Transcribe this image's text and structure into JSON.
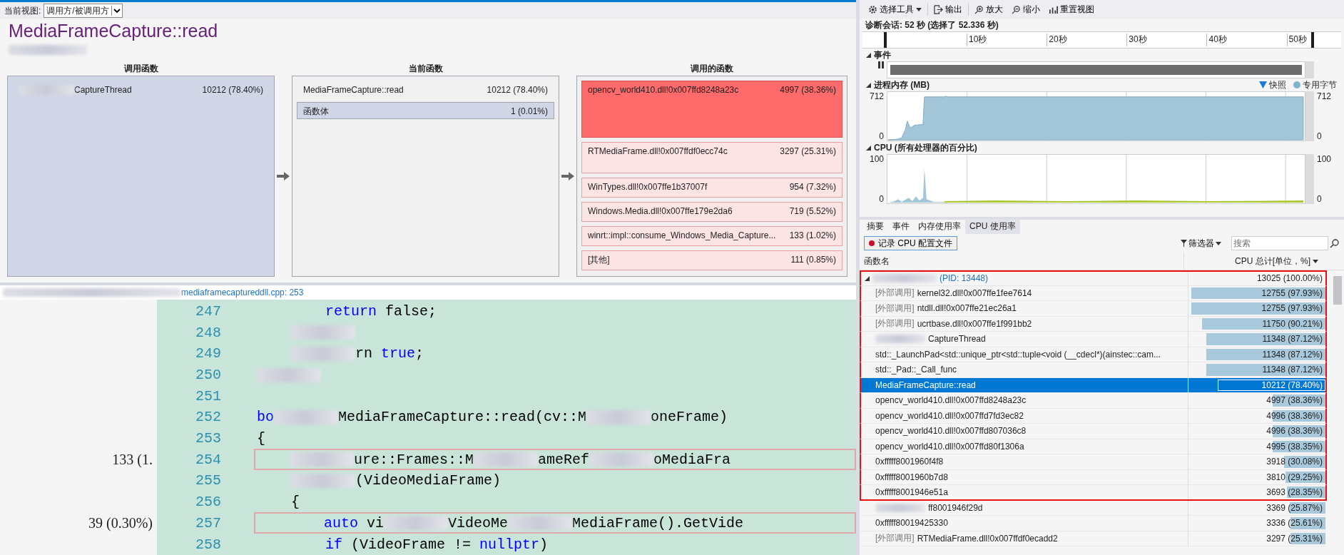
{
  "left": {
    "toolbar": {
      "label": "当前视图:",
      "view": "调用方/被调用方"
    },
    "title": "MediaFrameCapture::read",
    "callers": {
      "heading": "调用函数",
      "items": [
        {
          "name": "CaptureThread",
          "value": "10212 (78.40%)",
          "redacted": true
        }
      ]
    },
    "current": {
      "heading": "当前函数",
      "function": {
        "name": "MediaFrameCapture::read",
        "value": "10212 (78.40%)"
      },
      "items": [
        {
          "name": "函数体",
          "value": "1 (0.01%)"
        }
      ]
    },
    "callees": {
      "heading": "调用的函数",
      "items": [
        {
          "name": "opencv_world410.dll!0x007ffd8248a23c",
          "value": "4997 (38.36%)",
          "hot": true
        },
        {
          "name": "RTMediaFrame.dll!0x007ffdf0ecc74c",
          "value": "3297 (25.31%)",
          "hot": false
        },
        {
          "name": "WinTypes.dll!0x007ffe1b37007f",
          "value": "954 (7.32%)",
          "hot": false
        },
        {
          "name": "Windows.Media.dll!0x007ffe179e2da6",
          "value": "719 (5.52%)",
          "hot": false
        },
        {
          "name": "winrt::impl::consume_Windows_Media_Capture...",
          "value": "133 (1.02%)",
          "hot": false
        },
        {
          "name": "[其他]",
          "value": "111 (0.85%)",
          "hot": false
        }
      ]
    },
    "file": {
      "path": "mediaframecaptureddll.cpp: 253",
      "redacted": true
    },
    "code": [
      {
        "number": "247",
        "boxed": false,
        "segments": [
          {
            "kind": "indent"
          },
          {
            "kind": "indent"
          },
          {
            "kind": "keyword",
            "text": "return"
          },
          {
            "kind": "plain",
            "text": " false;"
          }
        ]
      },
      {
        "number": "248",
        "boxed": false,
        "segments": [
          {
            "kind": "indent"
          },
          {
            "kind": "redacted"
          }
        ]
      },
      {
        "number": "249",
        "boxed": false,
        "segments": [
          {
            "kind": "indent"
          },
          {
            "kind": "redacted"
          },
          {
            "kind": "plain",
            "text": "rn "
          },
          {
            "kind": "keyword",
            "text": "true"
          },
          {
            "kind": "plain",
            "text": ";"
          }
        ]
      },
      {
        "number": "250",
        "boxed": false,
        "segments": [
          {
            "kind": "redacted"
          }
        ]
      },
      {
        "number": "251",
        "boxed": false
      },
      {
        "number": "252",
        "boxed": false,
        "segments": [
          {
            "kind": "keyword",
            "text": "bo"
          },
          {
            "kind": "redacted"
          },
          {
            "kind": "plain",
            "text": "MediaFrameCapture::read(cv::M"
          },
          {
            "kind": "redacted"
          },
          {
            "kind": "plain",
            "text": "oneFrame)"
          }
        ]
      },
      {
        "number": "253",
        "boxed": false,
        "segments": [
          {
            "kind": "plain",
            "text": "{"
          }
        ]
      },
      {
        "number": "254",
        "count": "133 (1.",
        "boxed": true,
        "segments": [
          {
            "kind": "indent"
          },
          {
            "kind": "redacted"
          },
          {
            "kind": "plain",
            "text": "ure::Frames::M"
          },
          {
            "kind": "redacted"
          },
          {
            "kind": "plain",
            "text": "ameRef"
          },
          {
            "kind": "redacted"
          },
          {
            "kind": "plain",
            "text": "oMediaFra"
          }
        ]
      },
      {
        "number": "255",
        "boxed": false,
        "segments": [
          {
            "kind": "indent"
          },
          {
            "kind": "redacted"
          },
          {
            "kind": "plain",
            "text": "(VideoMediaFrame)"
          }
        ]
      },
      {
        "number": "256",
        "boxed": false,
        "segments": [
          {
            "kind": "indent"
          },
          {
            "kind": "plain",
            "text": "{"
          }
        ]
      },
      {
        "number": "257",
        "count": "39 (0.30%)",
        "boxed": true,
        "segments": [
          {
            "kind": "indent"
          },
          {
            "kind": "indent"
          },
          {
            "kind": "keyword",
            "text": "auto"
          },
          {
            "kind": "plain",
            "text": " vi"
          },
          {
            "kind": "redacted"
          },
          {
            "kind": "plain",
            "text": "VideoMe"
          },
          {
            "kind": "redacted"
          },
          {
            "kind": "plain",
            "text": "MediaFrame().GetVide"
          }
        ]
      },
      {
        "number": "258",
        "boxed": false,
        "segments": [
          {
            "kind": "indent"
          },
          {
            "kind": "indent"
          },
          {
            "kind": "keyword",
            "text": "if"
          },
          {
            "kind": "plain",
            "text": " (VideoFrame != "
          },
          {
            "kind": "keyword",
            "text": "nullptr"
          },
          {
            "kind": "plain",
            "text": ")"
          }
        ]
      }
    ]
  },
  "right": {
    "toolbar": [
      {
        "label": "选择工具",
        "kind": "dropdown"
      },
      {
        "label": "输出",
        "kind": "button"
      },
      {
        "label": "放大",
        "kind": "button"
      },
      {
        "label": "缩小",
        "kind": "button"
      },
      {
        "label": "重置视图",
        "kind": "button"
      }
    ],
    "session": "诊断会话: 52 秒 (选择了 52.336 秒)",
    "ruler": [
      "10秒",
      "20秒",
      "30秒",
      "40秒",
      "50秒"
    ],
    "events": {
      "heading": "事件",
      "expanded": true
    },
    "memory": {
      "heading": "进程内存 (MB)",
      "expanded": true,
      "legend": [
        "快照",
        "专用字节"
      ],
      "left_axis": [
        "712",
        "0"
      ],
      "right_axis": [
        "712",
        "0"
      ]
    },
    "cpu": {
      "heading": "CPU (所有处理器的百分比)",
      "expanded": true,
      "left_axis": [
        "100",
        "0"
      ],
      "right_axis": [
        "100",
        "0"
      ]
    },
    "tabs": [
      {
        "label": "摘要",
        "selected": false
      },
      {
        "label": "事件",
        "selected": false
      },
      {
        "label": "内存使用率",
        "selected": false
      },
      {
        "label": "CPU 使用率",
        "selected": true
      }
    ],
    "record_button": "记录 CPU 配置文件",
    "filter": "筛选器",
    "search": {
      "placeholder": "搜索"
    },
    "columns": [
      "函数名",
      "CPU 总计[单位，%]"
    ],
    "tree": {
      "name": "(PID: 13448)",
      "value": "13025 (100.00%)",
      "redacted": true,
      "highlighted": true,
      "selected": false,
      "expanded": true,
      "children": [
        {
          "prefix": "[外部调用]",
          "name": "kernel32.dll!0x007ffe1fee7614",
          "value": "12755 (97.93%)",
          "level": 0.9793,
          "highlighted": true,
          "selected": false
        },
        {
          "prefix": "[外部调用]",
          "name": "ntdll.dll!0x007ffe21ec26a1",
          "value": "12755 (97.93%)",
          "level": 0.9793,
          "highlighted": true,
          "selected": false
        },
        {
          "prefix": "[外部调用]",
          "name": "ucrtbase.dll!0x007ffe1f991bb2",
          "value": "11750 (90.21%)",
          "level": 0.9021,
          "highlighted": true,
          "selected": false
        },
        {
          "name": "CaptureThread",
          "redacted": true,
          "value": "11348 (87.12%)",
          "level": 0.8712,
          "highlighted": true,
          "selected": false
        },
        {
          "name": "std::_LaunchPad<std::unique_ptr<std::tuple<void (__cdecl*)(ainstec::cam...",
          "value": "11348 (87.12%)",
          "level": 0.8712,
          "highlighted": true,
          "selected": false
        },
        {
          "name": "std::_Pad::_Call_func",
          "value": "11348 (87.12%)",
          "level": 0.8712,
          "highlighted": true,
          "selected": false
        },
        {
          "name": "MediaFrameCapture::read",
          "value": "10212 (78.40%)",
          "level": 0.784,
          "highlighted": true,
          "selected": true
        },
        {
          "name": "opencv_world410.dll!0x007ffd8248a23c",
          "value": "4997 (38.36%)",
          "level": 0.3836,
          "highlighted": true,
          "selected": false
        },
        {
          "name": "opencv_world410.dll!0x007ffd7fd3ec82",
          "value": "4996 (38.36%)",
          "level": 0.3836,
          "highlighted": true,
          "selected": false
        },
        {
          "name": "opencv_world410.dll!0x007ffd807036c8",
          "value": "4996 (38.36%)",
          "level": 0.3836,
          "highlighted": true,
          "selected": false
        },
        {
          "name": "opencv_world410.dll!0x007ffd80f1306a",
          "value": "4995 (38.35%)",
          "level": 0.3835,
          "highlighted": true,
          "selected": false
        },
        {
          "name": "0xfffff8001960f4f8",
          "value": "3918 (30.08%)",
          "level": 0.3008,
          "highlighted": true,
          "selected": false
        },
        {
          "name": "0xfffff8001960b7d8",
          "value": "3810 (29.25%)",
          "level": 0.2925,
          "highlighted": true,
          "selected": false
        },
        {
          "name": "0xfffff8001946e51a",
          "value": "3693 (28.35%)",
          "level": 0.2835,
          "highlighted": true,
          "selected": false
        },
        {
          "name": "ff8001946f29d",
          "redacted": true,
          "value": "3369 (25.87%)",
          "level": 0.2587,
          "highlighted": false,
          "selected": false
        },
        {
          "name": "0xfffff80019425330",
          "value": "3336 (25.61%)",
          "level": 0.2561,
          "highlighted": false,
          "selected": false
        },
        {
          "prefix": "[外部调用]",
          "name": "RTMediaFrame.dll!0x007ffdf0ecadd2",
          "value": "3297 (25.31%)",
          "level": 0.2531,
          "highlighted": false,
          "selected": false
        }
      ]
    }
  }
}
